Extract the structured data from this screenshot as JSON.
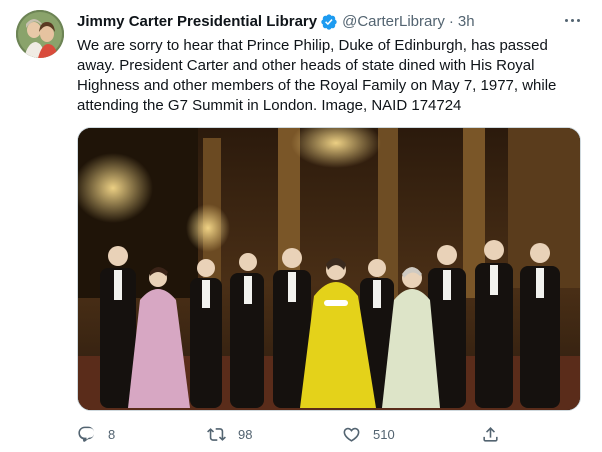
{
  "author": {
    "name": "Jimmy Carter Presidential Library",
    "handle": "@CarterLibrary",
    "separator": "·",
    "time": "3h"
  },
  "tweet": {
    "text": "We are sorry to hear that Prince Philip, Duke of Edinburgh, has passed away. President Carter and other heads of state dined with His Royal Highness and other members of the Royal Family on May 7, 1977, while attending the G7 Summit in London. Image, NAID 174724"
  },
  "actions": {
    "replies": "8",
    "retweets": "98",
    "likes": "510"
  },
  "icons": {
    "verified": "verified-badge-icon",
    "more": "more-options-icon",
    "reply": "reply-icon",
    "retweet": "retweet-icon",
    "like": "heart-icon",
    "share": "share-icon"
  },
  "colors": {
    "verified": "#1d9bf0",
    "secondary_text": "#536471",
    "primary_text": "#0f1419"
  }
}
